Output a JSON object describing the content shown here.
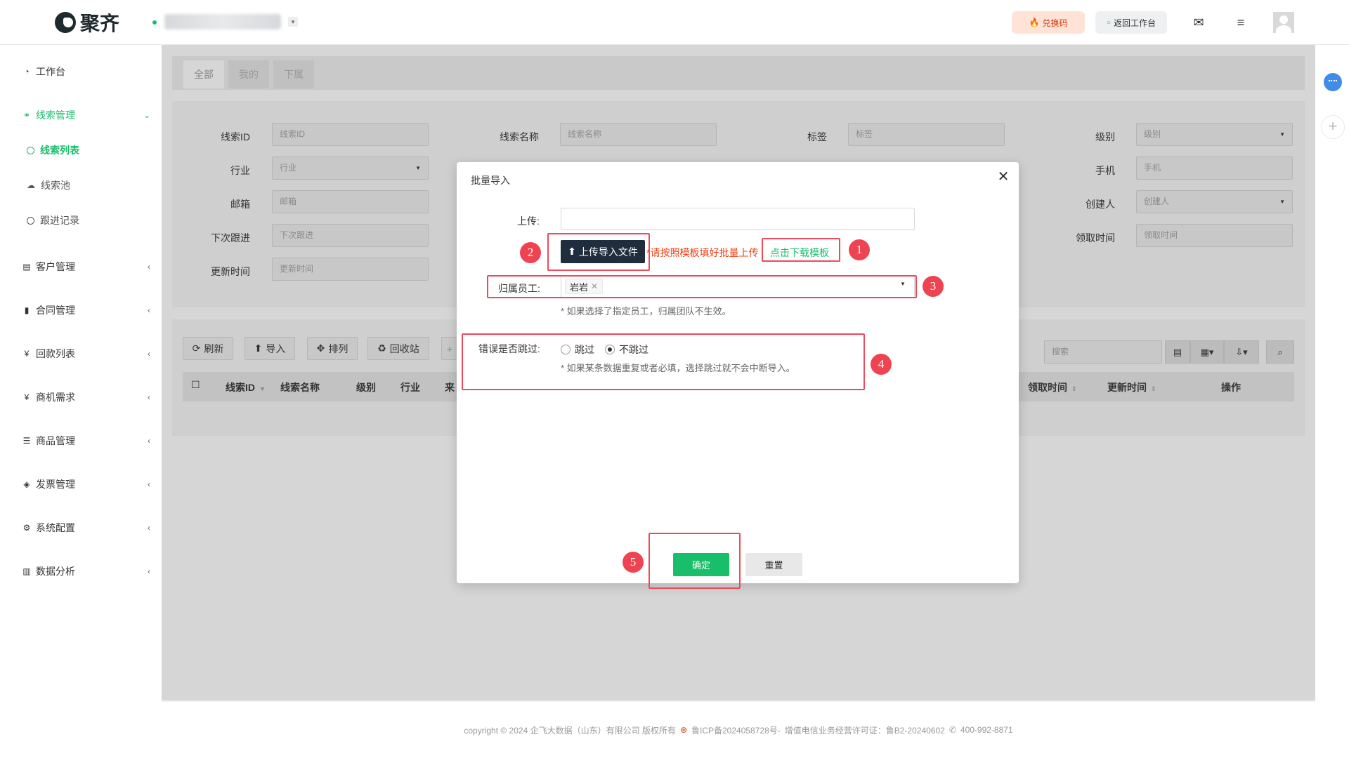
{
  "topbar": {
    "logo_text": "聚齐",
    "redeem_label": "兑换码",
    "back_label": "返回工作台",
    "mail_icon": "mail-icon",
    "menu_icon": "hamburger-menu-icon"
  },
  "sidebar": {
    "workbench": "工作台",
    "leads_mgmt": "线索管理",
    "leads_list": "线索列表",
    "leads_pool": "线索池",
    "follow_records": "跟进记录",
    "customer_mgmt": "客户管理",
    "contract_mgmt": "合同管理",
    "payment_list": "回款列表",
    "opportunity": "商机需求",
    "product_mgmt": "商品管理",
    "invoice_mgmt": "发票管理",
    "system_config": "系统配置",
    "data_analysis": "数据分析"
  },
  "tabs": [
    "全部",
    "我的",
    "下属"
  ],
  "filters": {
    "lead_id_label": "线索ID",
    "lead_id_ph": "线索ID",
    "lead_name_label": "线索名称",
    "lead_name_ph": "线索名称",
    "tag_label": "标签",
    "tag_ph": "标签",
    "level_label": "级别",
    "level_ph": "级别",
    "industry_label": "行业",
    "industry_ph": "行业",
    "phone_label": "手机",
    "phone_ph": "手机",
    "email_label": "邮箱",
    "email_ph": "邮箱",
    "creator_label": "创建人",
    "creator_ph": "创建人",
    "next_follow_label": "下次跟进",
    "next_follow_ph": "下次跟进",
    "claim_time_label": "领取时间",
    "claim_time_ph": "领取时间",
    "update_time_label": "更新时间",
    "update_time_ph": "更新时间"
  },
  "toolbar": {
    "refresh": "刷新",
    "import": "导入",
    "sort": "排列",
    "recycle": "回收站",
    "search_ph": "搜索"
  },
  "table": {
    "columns": [
      "线索ID",
      "线索名称",
      "级别",
      "行业",
      "来",
      "领取时间",
      "更新时间",
      "操作"
    ]
  },
  "modal": {
    "title": "批量导入",
    "upload_label": "上传:",
    "upload_button": "上传导入文件",
    "template_tip": "*请按照模板填好批量上传",
    "download_link": "点击下载模板",
    "employee_label": "归属员工:",
    "employee_tag": "岩岩",
    "employee_hint": "* 如果选择了指定员工，归属团队不生效。",
    "skip_label": "错误是否跳过:",
    "skip_option": "跳过",
    "noskip_option": "不跳过",
    "selected_option": "不跳过",
    "skip_hint": "* 如果某条数据重复或者必填，选择跳过就不会中断导入。",
    "confirm": "确定",
    "reset": "重置"
  },
  "annotations": [
    "1",
    "2",
    "3",
    "4",
    "5"
  ],
  "footer": {
    "copyright": "copyright © 2024 企飞大数据（山东）有限公司 版权所有",
    "icp": "鲁ICP备2024058728号-",
    "license": "增值电信业务经营许可证：鲁B2-20240602",
    "phone": "400-992-8871"
  },
  "colors": {
    "accent": "#19be6b",
    "annotation": "#ee4452",
    "dark_button": "#1f2d3d",
    "tip_red": "#ed4014"
  }
}
